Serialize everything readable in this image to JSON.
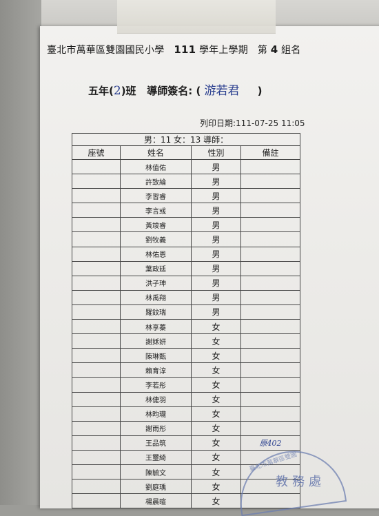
{
  "header": {
    "school": "臺北市萬華區雙園國民小學",
    "year": "111",
    "term": "學年上學期",
    "group_prefix": "第",
    "group_number": "4",
    "group_suffix": "組名"
  },
  "class_line": {
    "grade_prefix": "五年(",
    "class_number": "2",
    "grade_suffix": ")班",
    "teacher_label": "導師簽名:",
    "open_paren": "(",
    "teacher_signature": "游若君",
    "close_paren": ")"
  },
  "print_date": "列印日期:111-07-25 11:05",
  "summary": "男：11 女：13 導師：",
  "columns": [
    "座號",
    "姓名",
    "性別",
    "備註"
  ],
  "students": [
    {
      "seat": "",
      "name": "林值佑",
      "gender": "男",
      "note": ""
    },
    {
      "seat": "",
      "name": "許致綸",
      "gender": "男",
      "note": ""
    },
    {
      "seat": "",
      "name": "李習睿",
      "gender": "男",
      "note": ""
    },
    {
      "seat": "",
      "name": "李言彧",
      "gender": "男",
      "note": ""
    },
    {
      "seat": "",
      "name": "黃竣睿",
      "gender": "男",
      "note": ""
    },
    {
      "seat": "",
      "name": "劉牧義",
      "gender": "男",
      "note": ""
    },
    {
      "seat": "",
      "name": "林佑恩",
      "gender": "男",
      "note": ""
    },
    {
      "seat": "",
      "name": "葉政廷",
      "gender": "男",
      "note": ""
    },
    {
      "seat": "",
      "name": "洪子珅",
      "gender": "男",
      "note": ""
    },
    {
      "seat": "",
      "name": "林禹翔",
      "gender": "男",
      "note": ""
    },
    {
      "seat": "",
      "name": "羅鈫瑞",
      "gender": "男",
      "note": ""
    },
    {
      "seat": "",
      "name": "林享蓁",
      "gender": "女",
      "note": ""
    },
    {
      "seat": "",
      "name": "謝姀妍",
      "gender": "女",
      "note": ""
    },
    {
      "seat": "",
      "name": "陳琳甄",
      "gender": "女",
      "note": ""
    },
    {
      "seat": "",
      "name": "賴育淳",
      "gender": "女",
      "note": ""
    },
    {
      "seat": "",
      "name": "李若彤",
      "gender": "女",
      "note": ""
    },
    {
      "seat": "",
      "name": "林倢羽",
      "gender": "女",
      "note": ""
    },
    {
      "seat": "",
      "name": "林昀瓏",
      "gender": "女",
      "note": ""
    },
    {
      "seat": "",
      "name": "謝雨彤",
      "gender": "女",
      "note": ""
    },
    {
      "seat": "",
      "name": "王品筑",
      "gender": "女",
      "note": "原402"
    },
    {
      "seat": "",
      "name": "王璽綺",
      "gender": "女",
      "note": ""
    },
    {
      "seat": "",
      "name": "陳毓文",
      "gender": "女",
      "note": ""
    },
    {
      "seat": "",
      "name": "劉庭瑀",
      "gender": "女",
      "note": ""
    },
    {
      "seat": "",
      "name": "楊晨暄",
      "gender": "女",
      "note": ""
    }
  ],
  "stamp": {
    "arc_text": "臺北市萬華區雙園",
    "center_text": "教務處",
    "color": "#5a6ea8"
  }
}
